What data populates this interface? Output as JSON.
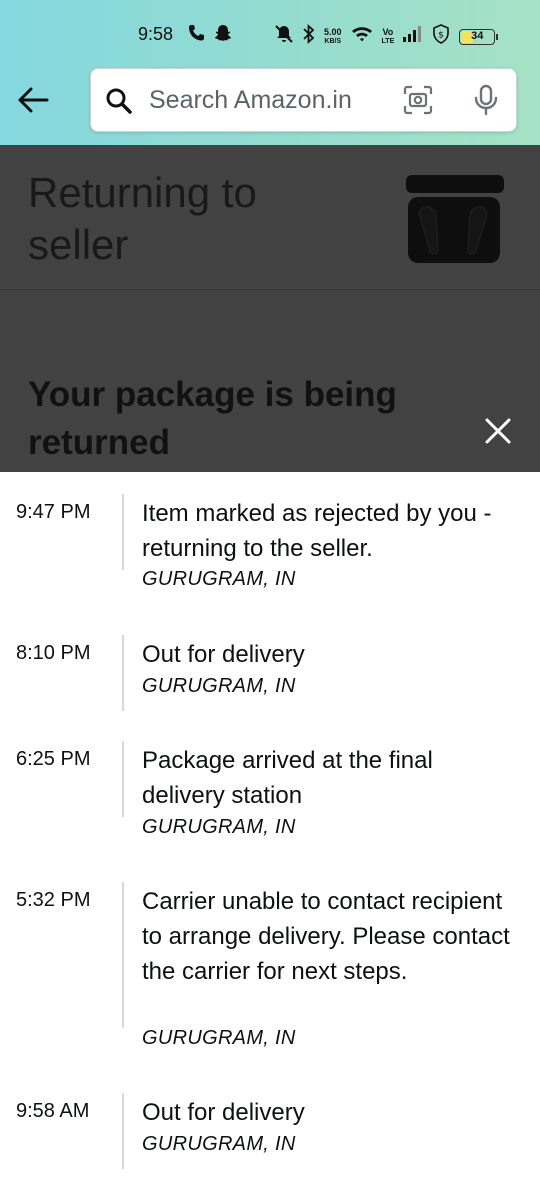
{
  "status_bar": {
    "time": "9:58",
    "net_speed_value": "5.00",
    "net_speed_unit": "KB/S",
    "volte_top": "Vo",
    "volte_bottom": "LTE",
    "battery_level": "34"
  },
  "header": {
    "search_placeholder": "Search Amazon.in"
  },
  "page": {
    "title": "Returning to seller",
    "subheading": "Your package is being returned"
  },
  "events": [
    {
      "time": "9:47 PM",
      "description": "Item marked as rejected by you - returning to the seller.",
      "location": "GURUGRAM, IN"
    },
    {
      "time": "8:10 PM",
      "description": "Out for delivery",
      "location": "GURUGRAM, IN"
    },
    {
      "time": "6:25 PM",
      "description": "Package arrived at the final delivery station",
      "location": "GURUGRAM, IN"
    },
    {
      "time": "5:32 PM",
      "description": "Carrier unable to contact recipient to arrange delivery. Please contact the carrier for next steps.",
      "location": "GURUGRAM, IN"
    },
    {
      "time": "9:58 AM",
      "description": "Out for delivery",
      "location": "GURUGRAM, IN"
    }
  ],
  "colors": {
    "header_gradient_start": "#84d8e0",
    "header_gradient_end": "#a6e2c6",
    "overlay": "#424242",
    "battery_fill": "#f2e35f"
  },
  "icons": [
    "phone-icon",
    "snapchat-icon",
    "mute-icon",
    "bluetooth-icon",
    "wifi-icon",
    "signal-icon",
    "vpn-shield-icon",
    "battery-icon",
    "back-arrow-icon",
    "search-icon",
    "camera-scan-icon",
    "microphone-icon",
    "close-icon"
  ]
}
